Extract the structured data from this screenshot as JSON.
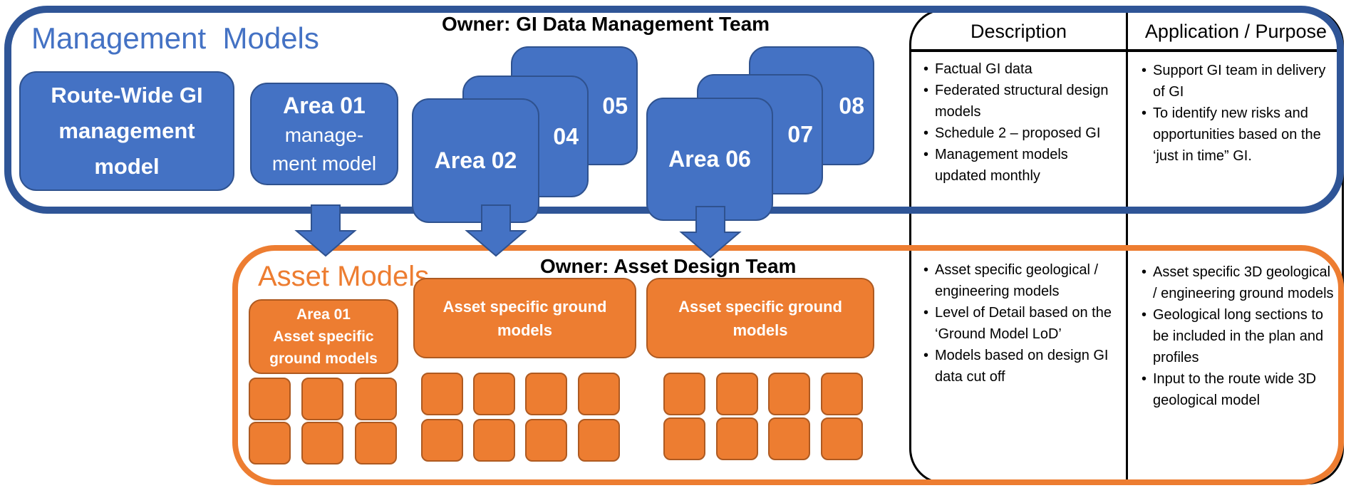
{
  "colors": {
    "management_blue": "#4472C4",
    "asset_orange": "#ED7D31",
    "frame_blue": "#2F5597"
  },
  "management": {
    "title": "Management  Models",
    "owner": "Owner: GI Data Management Team",
    "route_wide": [
      "Route-Wide GI",
      "management",
      "model"
    ],
    "area01": {
      "title": "Area 01",
      "subtitle": [
        "manage-",
        "ment model"
      ]
    },
    "stack1": {
      "front": "Area 02",
      "middle": "04",
      "back": "05"
    },
    "stack2": {
      "front": "Area 06",
      "middle": "07",
      "back": "08"
    }
  },
  "asset": {
    "title": "Asset Models",
    "owner": "Owner: Asset Design Team",
    "area01": [
      "Area 01",
      "Asset specific",
      "ground models"
    ],
    "group2": [
      "Asset specific ground",
      "models"
    ],
    "group3": [
      "Asset specific ground",
      "models"
    ]
  },
  "table": {
    "headers": {
      "description": "Description",
      "application": "Application / Purpose"
    },
    "management_description": [
      "Factual GI data",
      "Federated structural design models",
      "Schedule 2 – proposed GI",
      "Management models updated monthly"
    ],
    "management_application": [
      "Support GI team in delivery of GI",
      "To identify new risks and opportunities based on the ‘just in time” GI."
    ],
    "asset_description": [
      "Asset specific geological / engineering models",
      "Level of Detail based on the ‘Ground Model LoD’",
      "Models based on design GI data cut off"
    ],
    "asset_application": [
      "Asset specific 3D geological / engineering ground models",
      "Geological long sections to be included in the plan and profiles",
      "Input to the route wide 3D geological model"
    ]
  }
}
